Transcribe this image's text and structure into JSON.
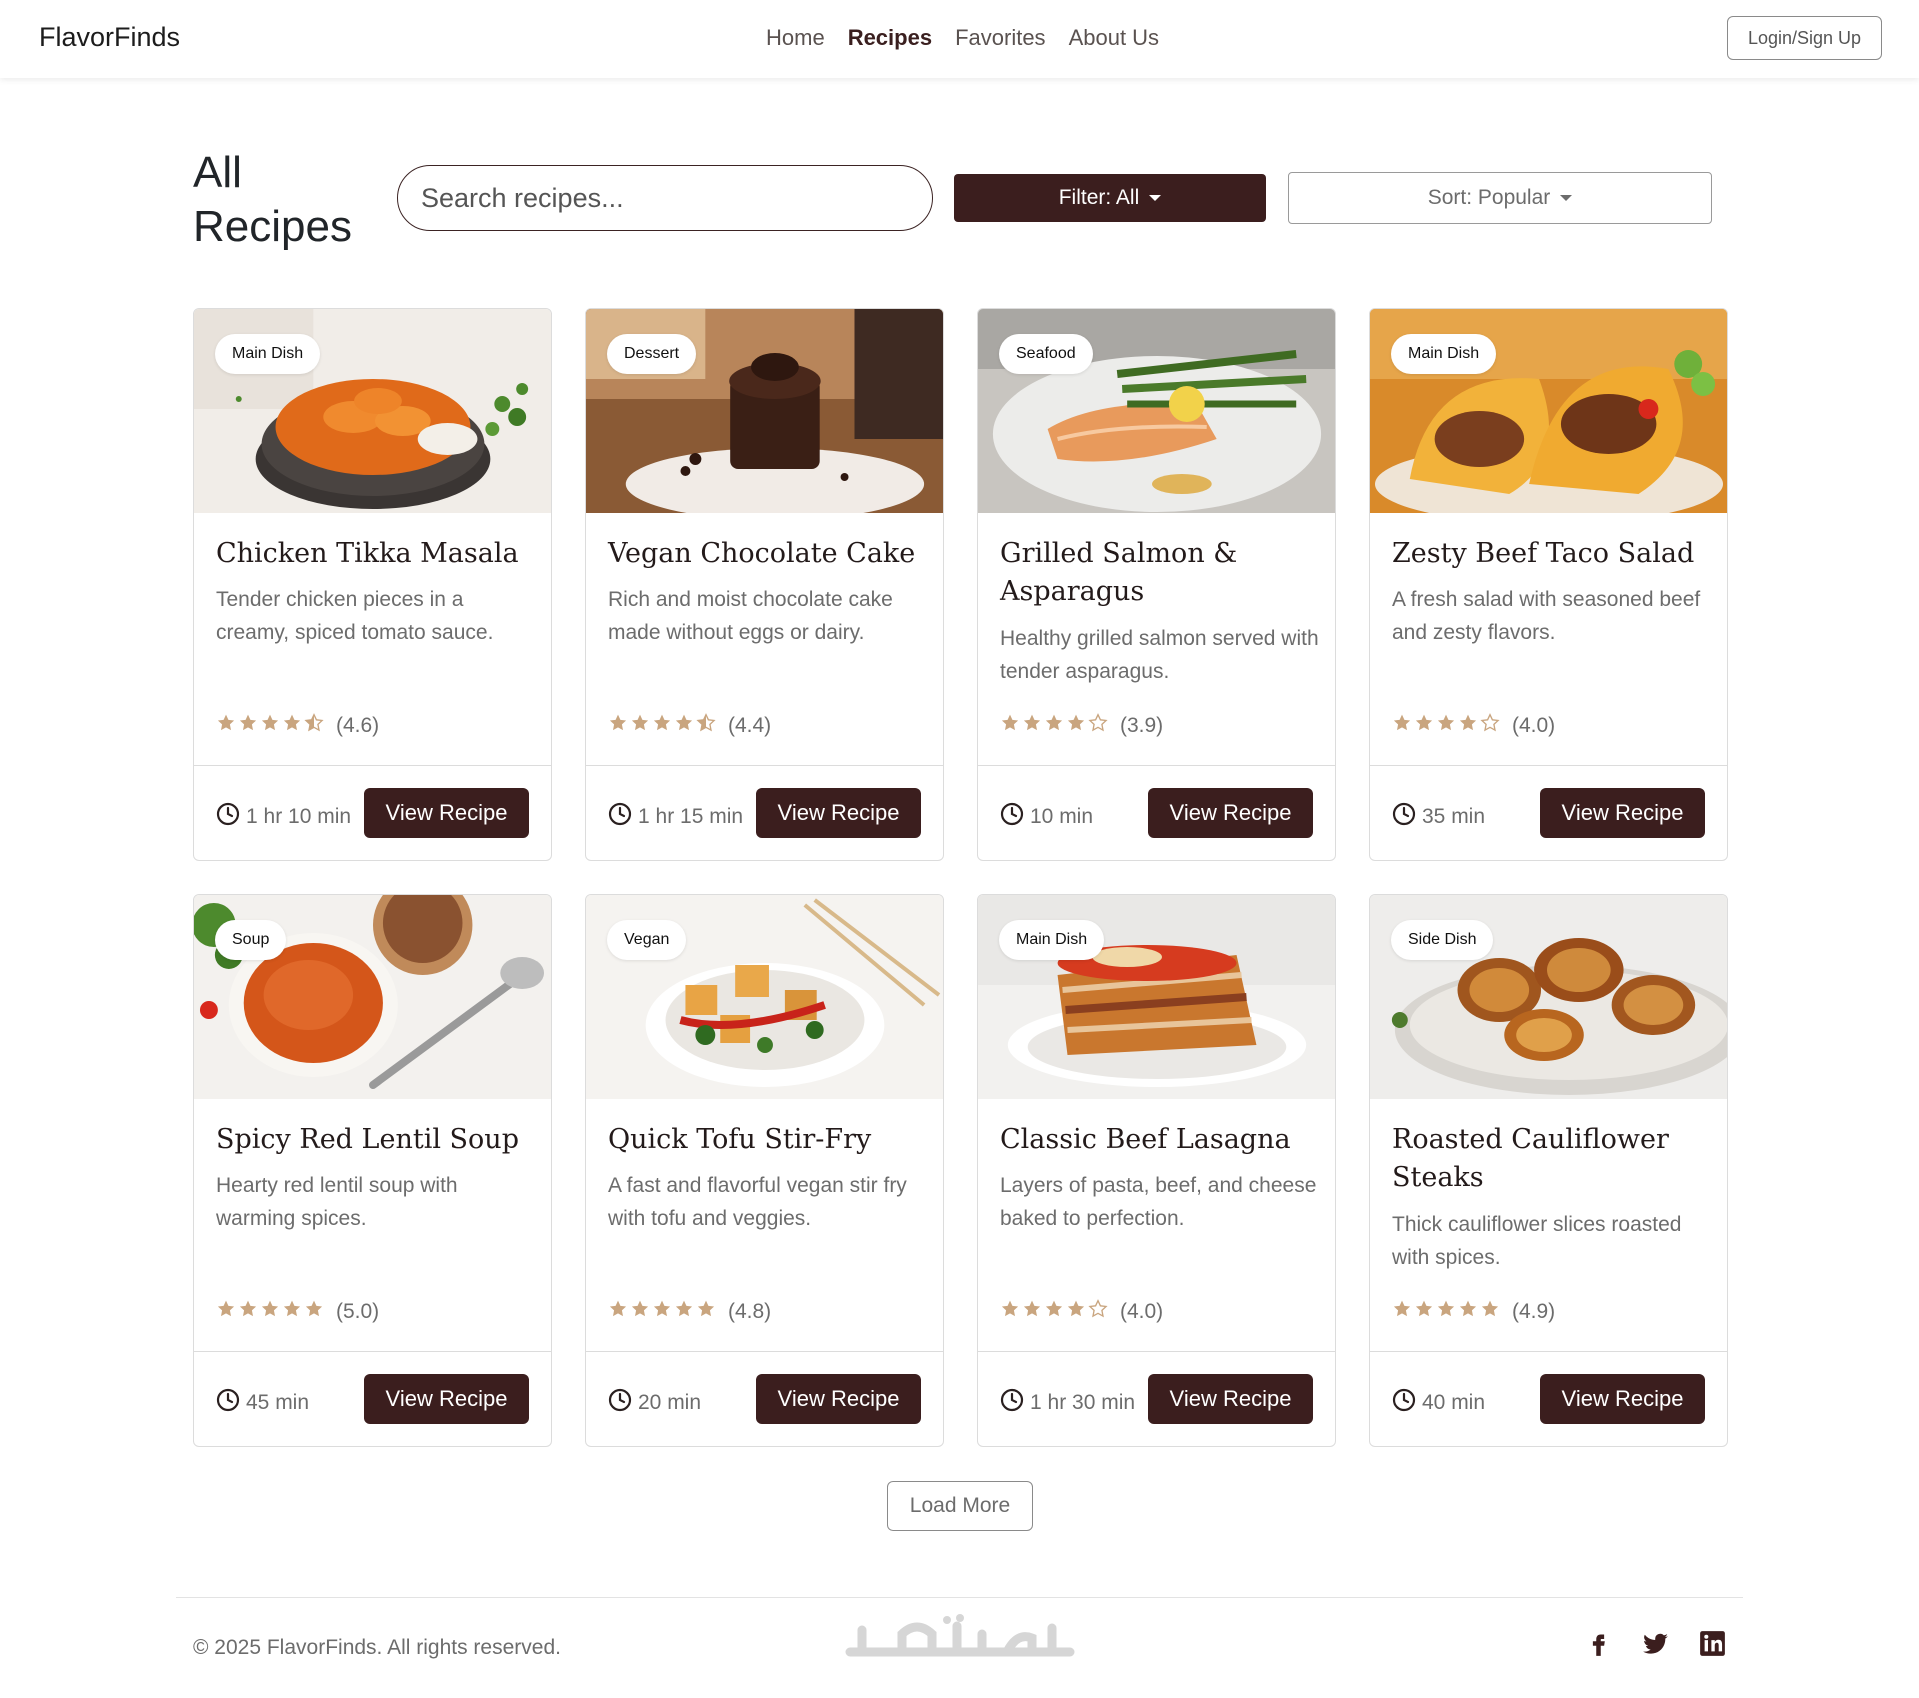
{
  "brand": "FlavorFinds",
  "nav": {
    "items": [
      {
        "label": "Home",
        "active": false
      },
      {
        "label": "Recipes",
        "active": true
      },
      {
        "label": "Favorites",
        "active": false
      },
      {
        "label": "About Us",
        "active": false
      }
    ],
    "login_label": "Login/Sign Up"
  },
  "page": {
    "title": "All Recipes",
    "search_placeholder": "Search recipes...",
    "filter_label": "Filter: All",
    "sort_label": "Sort: Popular"
  },
  "recipes": [
    {
      "category": "Main Dish",
      "title": "Chicken Tikka Masala",
      "description": "Tender chicken pieces in a creamy, spiced tomato sauce.",
      "rating": 4.6,
      "rating_label": "(4.6)",
      "time": "1 hr 10 min",
      "button": "View Recipe"
    },
    {
      "category": "Dessert",
      "title": "Vegan Chocolate Cake",
      "description": "Rich and moist chocolate cake made without eggs or dairy.",
      "rating": 4.4,
      "rating_label": "(4.4)",
      "time": "1 hr 15 min",
      "button": "View Recipe"
    },
    {
      "category": "Seafood",
      "title": "Grilled Salmon & Asparagus",
      "description": "Healthy grilled salmon served with tender asparagus.",
      "rating": 3.9,
      "rating_label": "(3.9)",
      "time": "10 min",
      "button": "View Recipe"
    },
    {
      "category": "Main Dish",
      "title": "Zesty Beef Taco Salad",
      "description": "A fresh salad with seasoned beef and zesty flavors.",
      "rating": 4.0,
      "rating_label": "(4.0)",
      "time": "35 min",
      "button": "View Recipe"
    },
    {
      "category": "Soup",
      "title": "Spicy Red Lentil Soup",
      "description": "Hearty red lentil soup with warming spices.",
      "rating": 5.0,
      "rating_label": "(5.0)",
      "time": "45 min",
      "button": "View Recipe"
    },
    {
      "category": "Vegan",
      "title": "Quick Tofu Stir-Fry",
      "description": "A fast and flavorful vegan stir fry with tofu and veggies.",
      "rating": 4.8,
      "rating_label": "(4.8)",
      "time": "20 min",
      "button": "View Recipe"
    },
    {
      "category": "Main Dish",
      "title": "Classic Beef Lasagna",
      "description": "Layers of pasta, beef, and cheese baked to perfection.",
      "rating": 4.0,
      "rating_label": "(4.0)",
      "time": "1 hr 30 min",
      "button": "View Recipe"
    },
    {
      "category": "Side Dish",
      "title": "Roasted Cauliflower Steaks",
      "description": "Thick cauliflower slices roasted with spices.",
      "rating": 4.9,
      "rating_label": "(4.9)",
      "time": "40 min",
      "button": "View Recipe"
    }
  ],
  "load_more_label": "Load More",
  "footer": {
    "copyright": "© 2025 FlavorFinds. All rights reserved.",
    "watermark": "خمسات",
    "socials": [
      "facebook-icon",
      "twitter-icon",
      "linkedin-icon"
    ]
  },
  "colors": {
    "primary": "#3b1e1e",
    "star": "#c9a57f",
    "muted_text": "#6c6c6c"
  }
}
